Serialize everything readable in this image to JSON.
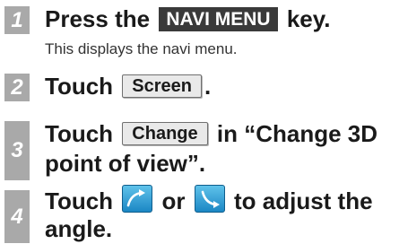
{
  "steps": [
    {
      "number": "1",
      "text_before": "Press the",
      "key_label": "NAVI MENU",
      "text_after": "key.",
      "subtext": "This displays the navi menu."
    },
    {
      "number": "2",
      "text_before": "Touch",
      "button_label": "Screen",
      "text_after": "."
    },
    {
      "number": "3",
      "text_before": "Touch",
      "button_label": "Change",
      "text_after": "in “Change 3D",
      "text_line2": "point of view”."
    },
    {
      "number": "4",
      "text_before": "Touch",
      "text_middle": "or",
      "text_after": "to adjust the",
      "text_line2": "angle.",
      "icons": [
        "tilt-up-icon",
        "tilt-down-icon"
      ]
    }
  ],
  "colors": {
    "number_badge": "#a9a9a9",
    "key_bg": "#3a3a3a",
    "icon_button": "#2a9fd8"
  }
}
